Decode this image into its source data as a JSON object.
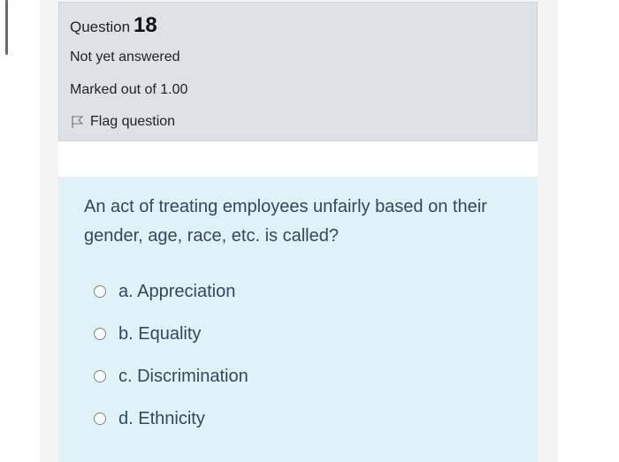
{
  "info": {
    "question_word": "Question",
    "question_number": "18",
    "state": "Not yet answered",
    "grade": "Marked out of 1.00",
    "flag_label": "Flag question"
  },
  "question": {
    "text": "An act of treating employees unfairly based on their gender, age, race, etc. is called?",
    "options": [
      {
        "label": "a. Appreciation"
      },
      {
        "label": "b. Equality"
      },
      {
        "label": "c. Discrimination"
      },
      {
        "label": "d. Ethnicity"
      }
    ]
  },
  "colors": {
    "info_bg": "#dee2e6",
    "question_bg": "#def2f8",
    "question_text": "#2f4a5c"
  }
}
